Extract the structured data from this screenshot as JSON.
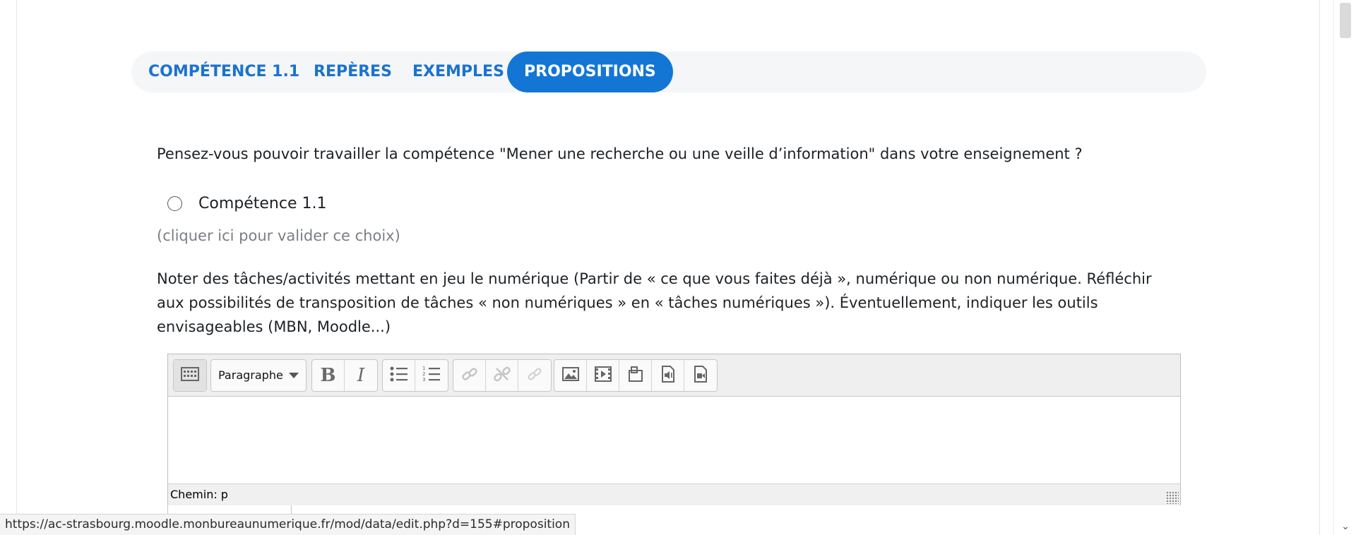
{
  "tabs": [
    {
      "label": "COMPÉTENCE 1.1",
      "active": false
    },
    {
      "label": "REPÈRES",
      "active": false
    },
    {
      "label": "EXEMPLES",
      "active": false
    },
    {
      "label": "PROPOSITIONS",
      "active": true
    }
  ],
  "question": "Pensez-vous pouvoir travailler la compétence \"Mener une recherche ou une veille d’information\" dans votre enseignement ?",
  "radio_option": {
    "label": "Compétence 1.1",
    "checked": false
  },
  "hint": "(cliquer ici pour valider ce choix)",
  "instructions": "Noter des tâches/activités mettant en jeu le numérique (Partir de « ce que vous faites déjà », numérique ou non numérique. Réfléchir aux possibilités de transposition de tâches « non numériques » en « tâches numériques »). Éventuellement, indiquer les outils envisageables (MBN, Moodle...)",
  "editor": {
    "format_value": "Paragraphe",
    "bold_glyph": "B",
    "italic_glyph": "I",
    "path_label": "Chemin: p",
    "content": ""
  },
  "status_url": "https://ac-strasbourg.moodle.monbureaunumerique.fr/mod/data/edit.php?d=155#proposition",
  "colors": {
    "accent": "#1476d4",
    "tab_text": "#1a73d0",
    "tab_bar_bg": "#f5f6f7",
    "hint": "#7b7f84"
  },
  "icons": [
    "toolbar-toggle-icon",
    "bold-icon",
    "italic-icon",
    "unordered-list-icon",
    "ordered-list-icon",
    "link-icon",
    "unlink-icon",
    "anchor-icon",
    "image-icon",
    "video-icon",
    "manage-files-icon",
    "record-audio-icon",
    "record-video-icon",
    "chevron-down-icon"
  ]
}
